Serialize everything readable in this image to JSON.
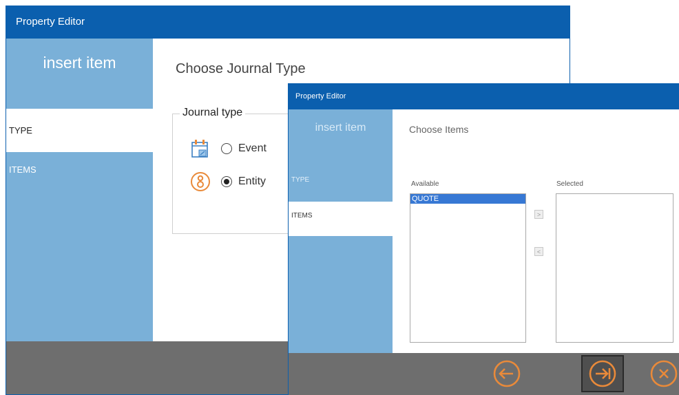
{
  "back_window": {
    "title": "Property Editor",
    "sidebar": {
      "heading": "insert item",
      "items": [
        {
          "label": "TYPE",
          "active": true
        },
        {
          "label": "ITEMS",
          "active": false
        }
      ]
    },
    "page_title": "Choose Journal Type",
    "group_label": "Journal type",
    "options": [
      {
        "label": "Event",
        "checked": false,
        "icon": "calendar-icon"
      },
      {
        "label": "Entity",
        "checked": true,
        "icon": "entity-icon"
      }
    ]
  },
  "front_window": {
    "title": "Property Editor",
    "sidebar": {
      "heading": "insert item",
      "items": [
        {
          "label": "TYPE",
          "active": false
        },
        {
          "label": "ITEMS",
          "active": true
        }
      ]
    },
    "page_title": "Choose Items",
    "available_label": "Available",
    "selected_label": "Selected",
    "available_items": [
      "QUOTE"
    ],
    "selected_items": [],
    "move_right": ">",
    "move_left": "<",
    "footer_buttons": [
      "back-icon",
      "next-icon",
      "cancel-icon"
    ]
  },
  "colors": {
    "titlebar": "#0b5fae",
    "sidebar": "#7ab0d8",
    "footer": "#6e6e6e",
    "accent_orange": "#e98a3a",
    "selection": "#3778d4"
  }
}
